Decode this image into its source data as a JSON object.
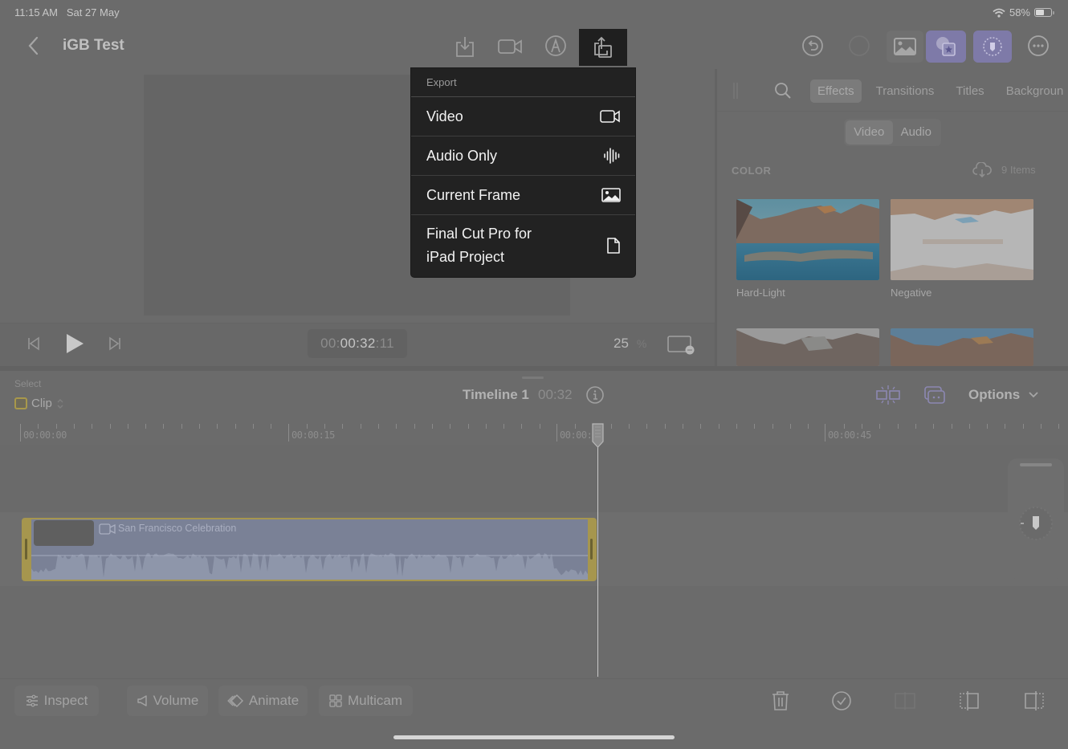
{
  "status_bar": {
    "time": "11:15 AM",
    "date": "Sat 27 May",
    "battery": "58%",
    "battery_level": 0.58
  },
  "nav": {
    "back_icon": "chevron-left-icon",
    "project_title": "iGB Test",
    "toolbar_icons": [
      "import-icon",
      "camera-icon",
      "voiceover-icon",
      "share-export-icon"
    ],
    "right_icons": [
      "undo-icon",
      "redo-icon",
      "photos-icon",
      "effects-browser-icon",
      "inspector-icon",
      "more-icon"
    ]
  },
  "export_menu": {
    "header": "Export",
    "items": [
      {
        "label": "Video",
        "icon": "video-camera-icon"
      },
      {
        "label": "Audio Only",
        "icon": "waveform-icon"
      },
      {
        "label": "Current Frame",
        "icon": "photo-icon"
      },
      {
        "label": "Final Cut Pro for\niPad Project",
        "icon": "document-icon"
      }
    ]
  },
  "viewer": {
    "timecode_prefix": "00:",
    "timecode_main": "00:32",
    "timecode_suffix": ":11",
    "zoom_value": "25",
    "zoom_unit": "%"
  },
  "browser": {
    "tabs": [
      "Effects",
      "Transitions",
      "Titles",
      "Backgroun"
    ],
    "active_tab": "Effects",
    "segments": [
      "Video",
      "Audio"
    ],
    "active_segment": "Video",
    "section": "COLOR",
    "items_count": "9 Items",
    "effects": [
      {
        "label": "Hard-Light"
      },
      {
        "label": "Negative"
      },
      {
        "label": ""
      },
      {
        "label": ""
      }
    ]
  },
  "timeline": {
    "select_label": "Select",
    "select_mode": "Clip",
    "title": "Timeline 1",
    "duration": "00:32",
    "options_label": "Options",
    "ruler_labels": [
      "00:00:00",
      "00:00:15",
      "00:00:30",
      "00:00:45"
    ],
    "clip_name": "San Francisco Celebration"
  },
  "bottom_toolbar": {
    "buttons": [
      {
        "label": "Inspect",
        "icon": "sliders-icon"
      },
      {
        "label": "Volume",
        "icon": "speaker-icon"
      },
      {
        "label": "Animate",
        "icon": "keyframe-icon"
      },
      {
        "label": "Multicam",
        "icon": "grid-icon"
      }
    ],
    "right_icons": [
      "trash-icon",
      "checkmark-circle-icon",
      "detach-icon",
      "split-left-icon",
      "split-right-icon"
    ]
  },
  "colors": {
    "accent_purple": "#7e7aa8",
    "clip_yellow": "#a6964e",
    "clip_blue": "#7a8196",
    "menu_bg": "#222222"
  }
}
